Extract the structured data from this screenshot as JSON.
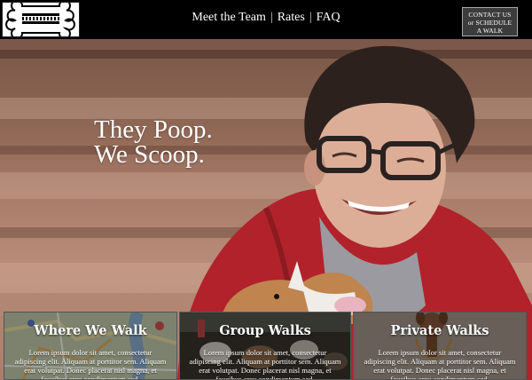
{
  "header": {
    "nav": [
      "Meet the Team",
      "Rates",
      "FAQ"
    ],
    "separator": "|",
    "cta_line1": "CONTACT US",
    "cta_line2": "or SCHEDULE",
    "cta_line3": "A WALK"
  },
  "hero": {
    "line1": "They Poop.",
    "line2": "We Scoop."
  },
  "cards": [
    {
      "title": "Where We Walk",
      "body": "Lorem ipsum dolor sit amet, consectetur adipiscing elit. Aliquam at porttitor sem. Aliquam erat volutpat. Donec placerat nisl magna, et faucibus arcu condimentum sed."
    },
    {
      "title": "Group Walks",
      "body": "Lorem ipsum dolor sit amet, consectetur adipiscing elit. Aliquam at porttitor sem. Aliquam erat volutpat. Donec placerat nisl magna, et faucibus arcu condimentum sed."
    },
    {
      "title": "Private Walks",
      "body": "Lorem ipsum dolor sit amet, consectetur adipiscing elit. Aliquam at porttitor sem. Aliquam erat volutpat. Donec placerat nisl magna, et faucibus arcu condimentum sed."
    }
  ]
}
